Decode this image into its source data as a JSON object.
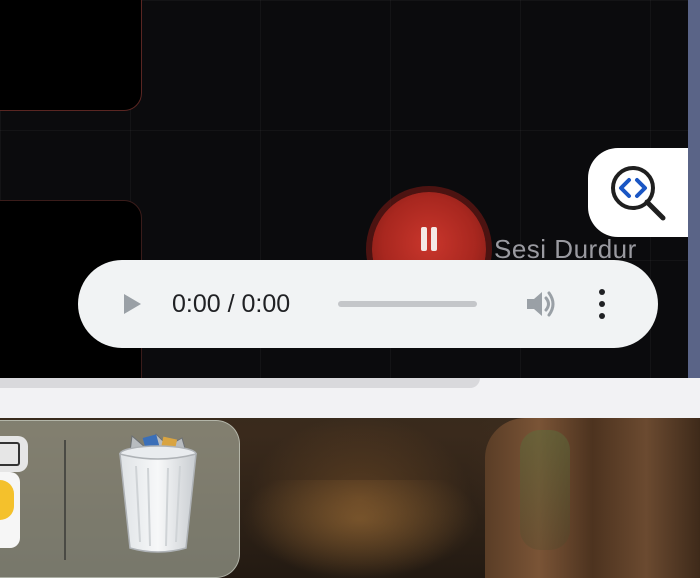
{
  "audio_player": {
    "time_display": "0:00 / 0:00",
    "progress_fraction": 0.0,
    "icons": {
      "play": "play-icon",
      "volume": "volume-icon",
      "menu": "more-options-icon"
    }
  },
  "pause_control": {
    "label": "Sesi Durdur",
    "icon": "pause-icon"
  },
  "inspector": {
    "icon": "inspect-zoom-icon"
  },
  "dock": {
    "items": [
      {
        "name": "app-partial-icon"
      },
      {
        "name": "trash-icon"
      }
    ]
  },
  "colors": {
    "accent_red": "#c9362c",
    "player_bg": "#f1f3f4",
    "dark_bg": "#0b0b0d",
    "inspector_blue": "#1a56c4"
  }
}
